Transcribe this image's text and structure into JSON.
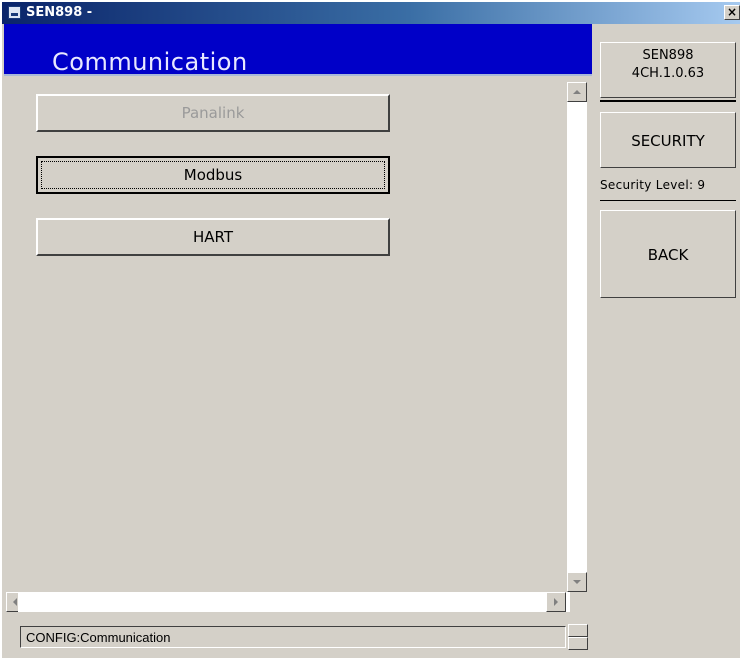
{
  "window": {
    "title": "SEN898 -",
    "close_label": "×"
  },
  "header": {
    "title": "Communication"
  },
  "buttons": [
    {
      "label": "Panalink",
      "state": "disabled"
    },
    {
      "label": "Modbus",
      "state": "focused"
    },
    {
      "label": "HART",
      "state": "normal"
    }
  ],
  "sidebar": {
    "device_name": "SEN898",
    "version": "4CH.1.0.63",
    "security_label": "SECURITY",
    "security_level_text": "Security Level: 9",
    "back_label": "BACK"
  },
  "status": {
    "text": "CONFIG:Communication"
  },
  "colors": {
    "header_bg": "#0000c8",
    "face": "#d4d0c8",
    "disabled_text": "#9a9a9a"
  }
}
